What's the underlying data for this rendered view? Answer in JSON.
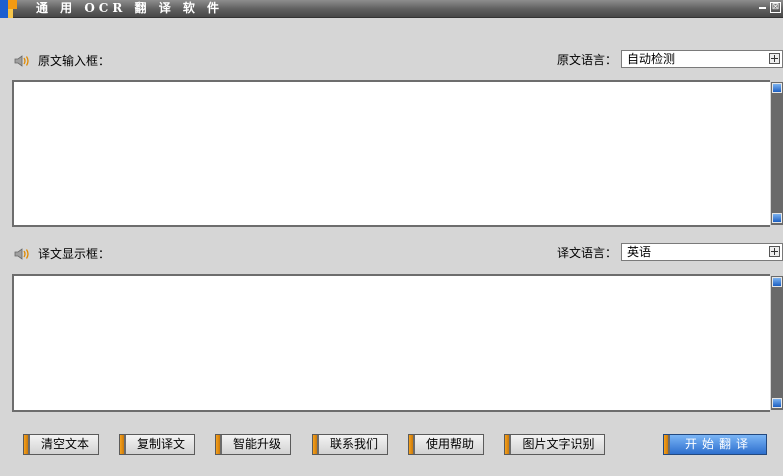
{
  "window": {
    "title": "通 用 OCR 翻 译 软 件",
    "minimize_glyph": "",
    "close_glyph": "⊠"
  },
  "source": {
    "label": "原文输入框：",
    "lang_label": "原文语言：",
    "lang_value": "自动检测",
    "text": ""
  },
  "target": {
    "label": "译文显示框：",
    "lang_label": "译文语言：",
    "lang_value": "英语",
    "text": ""
  },
  "buttons": {
    "clear": "清空文本",
    "copy": "复制译文",
    "upgrade": "智能升级",
    "contact": "联系我们",
    "help": "使用帮助",
    "ocr": "图片文字识别",
    "translate": "开始翻译"
  },
  "icons": {
    "logo": "app-logo",
    "speaker": "speaker-icon",
    "dropdown": "dropdown-icon"
  },
  "colors": {
    "accent_blue": "#2d6fce",
    "accent_orange": "#f5a11d",
    "window_bg": "#d6d6d6",
    "titlebar": "#5e5e5e"
  }
}
